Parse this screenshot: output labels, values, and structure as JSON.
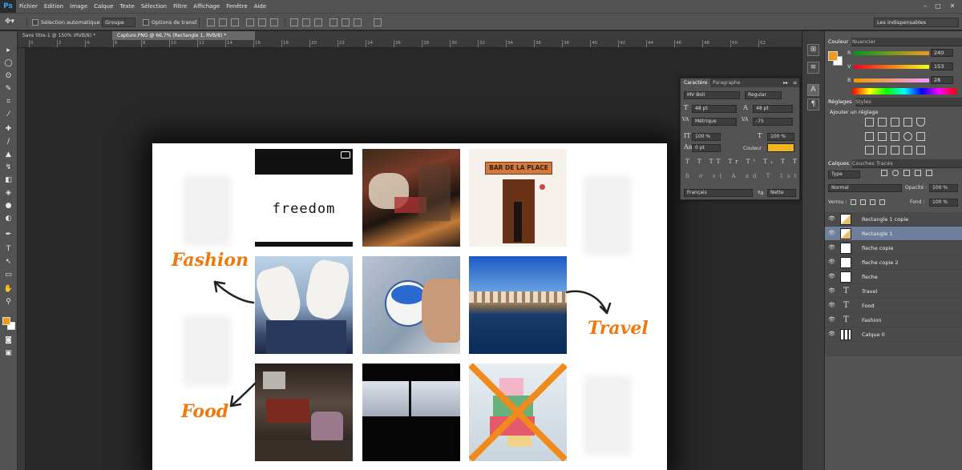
{
  "app": {
    "logo": "Ps",
    "menus": [
      "Fichier",
      "Edition",
      "Image",
      "Calque",
      "Texte",
      "Sélection",
      "Filtre",
      "Affichage",
      "Fenêtre",
      "Aide"
    ],
    "window_controls": [
      "–",
      "□",
      "✕"
    ]
  },
  "options_bar": {
    "auto_select_label": "Sélection automatique :",
    "auto_select_value": "Groupe",
    "transform_label": "Options de transf.",
    "workspace_value": "Les indispensables"
  },
  "doc_tabs": [
    {
      "label": "Sans titre-1 @ 150% (RVB/8) *",
      "active": false
    },
    {
      "label": "Capture.PNG @ 66,7% (Rectangle 1, RVB/8) *",
      "active": true
    }
  ],
  "ruler_numbers": [
    "0",
    "2",
    "4",
    "6",
    "8",
    "10",
    "12",
    "14",
    "16",
    "18",
    "20",
    "22",
    "24",
    "26",
    "28",
    "30",
    "32",
    "34",
    "36",
    "38",
    "40",
    "42",
    "44",
    "46",
    "48",
    "50",
    "52"
  ],
  "canvas": {
    "labels": {
      "fashion": "Fashion",
      "travel": "Travel",
      "food": "Food",
      "freedom": "freedom",
      "sign": "BAR DE LA PLACE"
    }
  },
  "color_panel": {
    "tabs": [
      "Couleur",
      "Nuancier"
    ],
    "channels": [
      {
        "label": "R",
        "value": "240"
      },
      {
        "label": "V",
        "value": "153"
      },
      {
        "label": "B",
        "value": "28"
      }
    ],
    "foreground": "#f09a1c"
  },
  "adjust_panel": {
    "tabs": [
      "Réglages",
      "Styles"
    ],
    "heading": "Ajouter un réglage"
  },
  "layers_panel": {
    "tabs": [
      "Calques",
      "Couches",
      "Tracés"
    ],
    "filter_value": "Type",
    "blend_mode": "Normal",
    "opacity_label": "Opacité :",
    "opacity_value": "100 %",
    "lock_label": "Verrou :",
    "fill_label": "Fond :",
    "fill_value": "100 %",
    "layers": [
      {
        "name": "Rectangle 1 copie",
        "kind": "image",
        "selected": false
      },
      {
        "name": "Rectangle 1",
        "kind": "image",
        "selected": true
      },
      {
        "name": "fleche copie",
        "kind": "image",
        "selected": false
      },
      {
        "name": "fleche copie 2",
        "kind": "image",
        "selected": false
      },
      {
        "name": "fleche",
        "kind": "image",
        "selected": false
      },
      {
        "name": "Travel",
        "kind": "text",
        "selected": false
      },
      {
        "name": "Food",
        "kind": "text",
        "selected": false
      },
      {
        "name": "Fashion",
        "kind": "text",
        "selected": false
      },
      {
        "name": "Calque 0",
        "kind": "image",
        "selected": false
      }
    ]
  },
  "char_panel": {
    "tabs": [
      "Caractère",
      "Paragraphe"
    ],
    "font": "MV Boli",
    "style": "Regular",
    "size": "48 pt",
    "leading": "48 pt",
    "kerning": "Métrique",
    "tracking": "-75",
    "vscale": "100 %",
    "hscale": "100 %",
    "baseline": "0 pt",
    "color_label": "Couleur :",
    "language": "Français",
    "antialias": "Nette"
  }
}
